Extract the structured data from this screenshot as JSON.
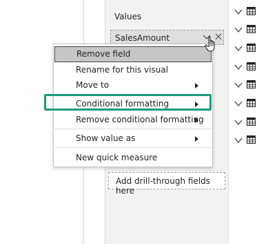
{
  "visualizations": {
    "values_label": "Values",
    "field": {
      "name": "SalesAmount"
    },
    "drill_through_placeholder": "Add drill-through fields here"
  },
  "context_menu": {
    "items": [
      {
        "label": "Remove field",
        "has_submenu": false,
        "hovered": true
      },
      {
        "label": "Rename for this visual",
        "has_submenu": false
      },
      {
        "label": "Move to",
        "has_submenu": true
      },
      {
        "label": "Conditional formatting",
        "has_submenu": true,
        "callout": true
      },
      {
        "label": "Remove conditional formatting",
        "has_submenu": true
      },
      {
        "label": "Show value as",
        "has_submenu": true
      },
      {
        "label": "New quick measure",
        "has_submenu": false
      }
    ]
  },
  "colors": {
    "callout": "#1d9a7a",
    "pane_bg": "#f3f2f1",
    "hover_bg": "#c8c6c4"
  },
  "fields_pane": {
    "table_rows": [
      {
        "icon": "table-icon",
        "collapsed": true
      },
      {
        "icon": "table-icon",
        "collapsed": true
      },
      {
        "icon": "table-icon",
        "collapsed": true
      },
      {
        "icon": "table-icon",
        "collapsed": true
      },
      {
        "icon": "table-icon",
        "collapsed": true
      },
      {
        "icon": "table-icon",
        "collapsed": true
      },
      {
        "icon": "table-icon",
        "collapsed": true
      },
      {
        "icon": "table-icon",
        "collapsed": true
      }
    ]
  }
}
